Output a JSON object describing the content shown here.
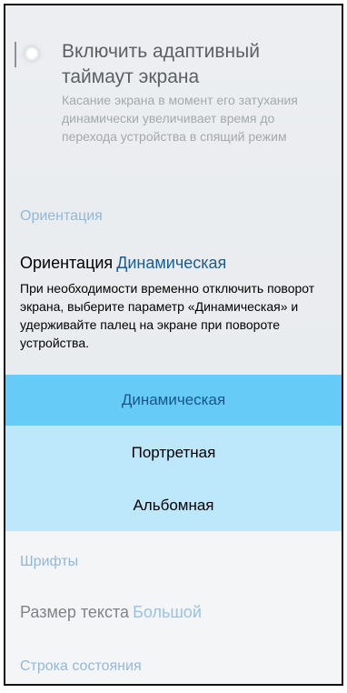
{
  "adaptive_timeout": {
    "title": "Включить адаптивный таймаут экрана",
    "description": "Касание экрана в момент его затухания динамически увеличивает время до перехода устройства в спящий режим"
  },
  "orientation_section": {
    "header": "Ориентация",
    "setting_label": "Ориентация",
    "setting_value": "Динамическая",
    "description": "При необходимости временно отключить поворот экрана, выберите параметр «Динамическая» и удерживайте палец на экране при повороте устройства."
  },
  "orientation_menu": {
    "options": [
      {
        "label": "Динамическая",
        "selected": true
      },
      {
        "label": "Портретная",
        "selected": false
      },
      {
        "label": "Альбомная",
        "selected": false
      }
    ]
  },
  "fonts_section": {
    "header": "Шрифты",
    "text_size_label": "Размер текста",
    "text_size_value": "Большой"
  },
  "status_bar_section": {
    "header": "Строка состояния"
  },
  "colors": {
    "selected_option_bg": "#66cbf6",
    "menu_bg": "#bde7fb",
    "value_accent": "#1a5d92",
    "section_header": "#93b8d6"
  }
}
